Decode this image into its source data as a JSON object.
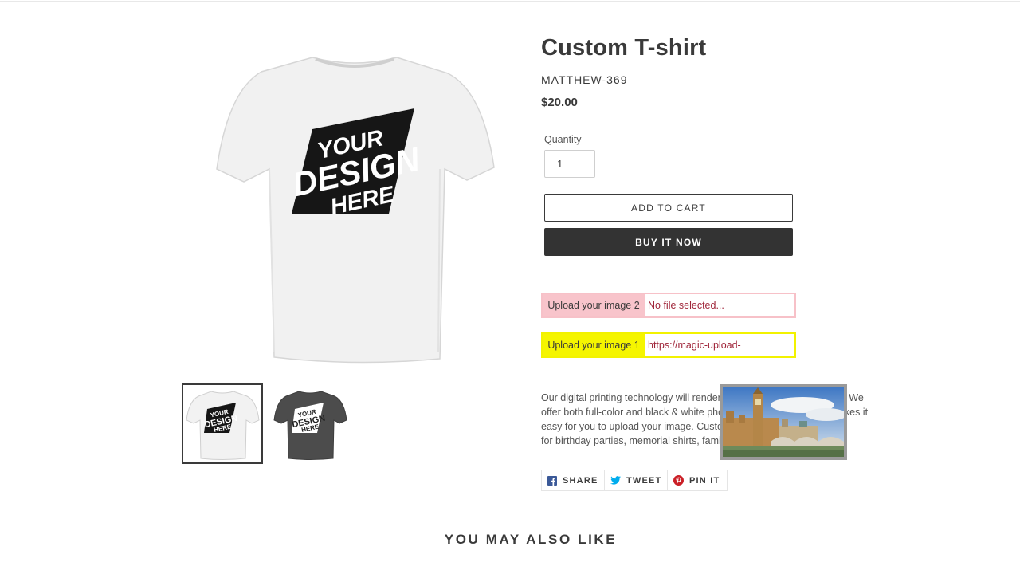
{
  "product": {
    "title": "Custom T-shirt",
    "vendor": "MATTHEW-369",
    "price": "$20.00"
  },
  "quantity": {
    "label": "Quantity",
    "value": "1"
  },
  "buttons": {
    "add_to_cart": "Add to cart",
    "buy_now": "Buy it now"
  },
  "uploads": [
    {
      "label": "Upload your image 2",
      "value": "No file selected...",
      "color": "#f8c4cb"
    },
    {
      "label": "Upload your image 1",
      "value": "https://magic-upload-",
      "color": "#f5f500"
    }
  ],
  "shirt_print": [
    "YOUR",
    "DESIGN",
    "HERE"
  ],
  "description": {
    "line1_a": "Our digital printing technology will render a",
    "line1_b": "We",
    "line2_a": "offer both full-color and black & white photo",
    "line2_b": "makes it",
    "line3_a": "easy for you to upload your image. Custom",
    "line4_a": "for birthday parties, memorial shirts, family"
  },
  "share": {
    "facebook": "SHARE",
    "twitter": "TWEET",
    "pinterest": "PIN IT"
  },
  "related_heading": "YOU MAY ALSO LIKE",
  "colors": {
    "text": "#3a3a3a",
    "buy_button": "#333333",
    "upload_value": "#a0263a",
    "facebook": "#3b5998",
    "twitter": "#00aced",
    "pinterest": "#cb2027"
  }
}
